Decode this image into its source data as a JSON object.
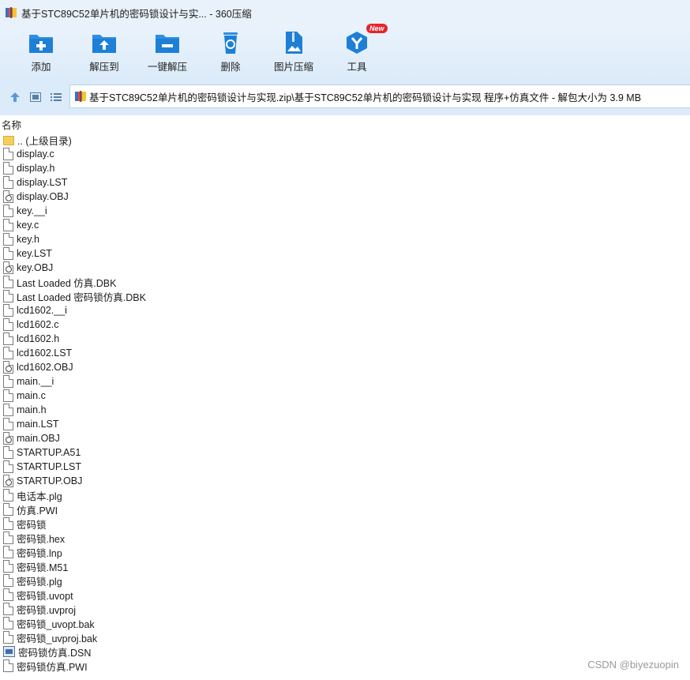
{
  "window": {
    "title": "基于STC89C52单片机的密码锁设计与实... - 360压缩"
  },
  "toolbar": {
    "items": [
      {
        "label": "添加",
        "icon": "add-icon"
      },
      {
        "label": "解压到",
        "icon": "extract-to-icon"
      },
      {
        "label": "一键解压",
        "icon": "one-click-extract-icon"
      },
      {
        "label": "删除",
        "icon": "delete-icon"
      },
      {
        "label": "图片压缩",
        "icon": "image-compress-icon"
      },
      {
        "label": "工具",
        "icon": "tools-icon",
        "badge": "New"
      }
    ]
  },
  "address": {
    "path": "基于STC89C52单片机的密码锁设计与实现.zip\\基于STC89C52单片机的密码锁设计与实现 程序+仿真文件 - 解包大小为 3.9 MB"
  },
  "list": {
    "header_name": "名称",
    "files": [
      {
        "name": ".. (上级目录)",
        "type": "folder"
      },
      {
        "name": "display.c",
        "type": "file"
      },
      {
        "name": "display.h",
        "type": "file"
      },
      {
        "name": "display.LST",
        "type": "file"
      },
      {
        "name": "display.OBJ",
        "type": "obj"
      },
      {
        "name": "key.__i",
        "type": "file"
      },
      {
        "name": "key.c",
        "type": "file"
      },
      {
        "name": "key.h",
        "type": "file"
      },
      {
        "name": "key.LST",
        "type": "file"
      },
      {
        "name": "key.OBJ",
        "type": "obj"
      },
      {
        "name": "Last Loaded 仿真.DBK",
        "type": "file"
      },
      {
        "name": "Last Loaded 密码锁仿真.DBK",
        "type": "file"
      },
      {
        "name": "lcd1602.__i",
        "type": "file"
      },
      {
        "name": "lcd1602.c",
        "type": "file"
      },
      {
        "name": "lcd1602.h",
        "type": "file"
      },
      {
        "name": "lcd1602.LST",
        "type": "file"
      },
      {
        "name": "lcd1602.OBJ",
        "type": "obj"
      },
      {
        "name": "main.__i",
        "type": "file"
      },
      {
        "name": "main.c",
        "type": "file"
      },
      {
        "name": "main.h",
        "type": "file"
      },
      {
        "name": "main.LST",
        "type": "file"
      },
      {
        "name": "main.OBJ",
        "type": "obj"
      },
      {
        "name": "STARTUP.A51",
        "type": "file"
      },
      {
        "name": "STARTUP.LST",
        "type": "file"
      },
      {
        "name": "STARTUP.OBJ",
        "type": "obj"
      },
      {
        "name": "电话本.plg",
        "type": "file"
      },
      {
        "name": "仿真.PWI",
        "type": "file"
      },
      {
        "name": "密码锁",
        "type": "file"
      },
      {
        "name": "密码锁.hex",
        "type": "file"
      },
      {
        "name": "密码锁.lnp",
        "type": "file"
      },
      {
        "name": "密码锁.M51",
        "type": "file"
      },
      {
        "name": "密码锁.plg",
        "type": "file"
      },
      {
        "name": "密码锁.uvopt",
        "type": "file"
      },
      {
        "name": "密码锁.uvproj",
        "type": "file"
      },
      {
        "name": "密码锁_uvopt.bak",
        "type": "file"
      },
      {
        "name": "密码锁_uvproj.bak",
        "type": "file"
      },
      {
        "name": "密码锁仿真.DSN",
        "type": "dsn"
      },
      {
        "name": "密码锁仿真.PWI",
        "type": "file"
      }
    ]
  },
  "watermark": "CSDN @biyezuopin"
}
